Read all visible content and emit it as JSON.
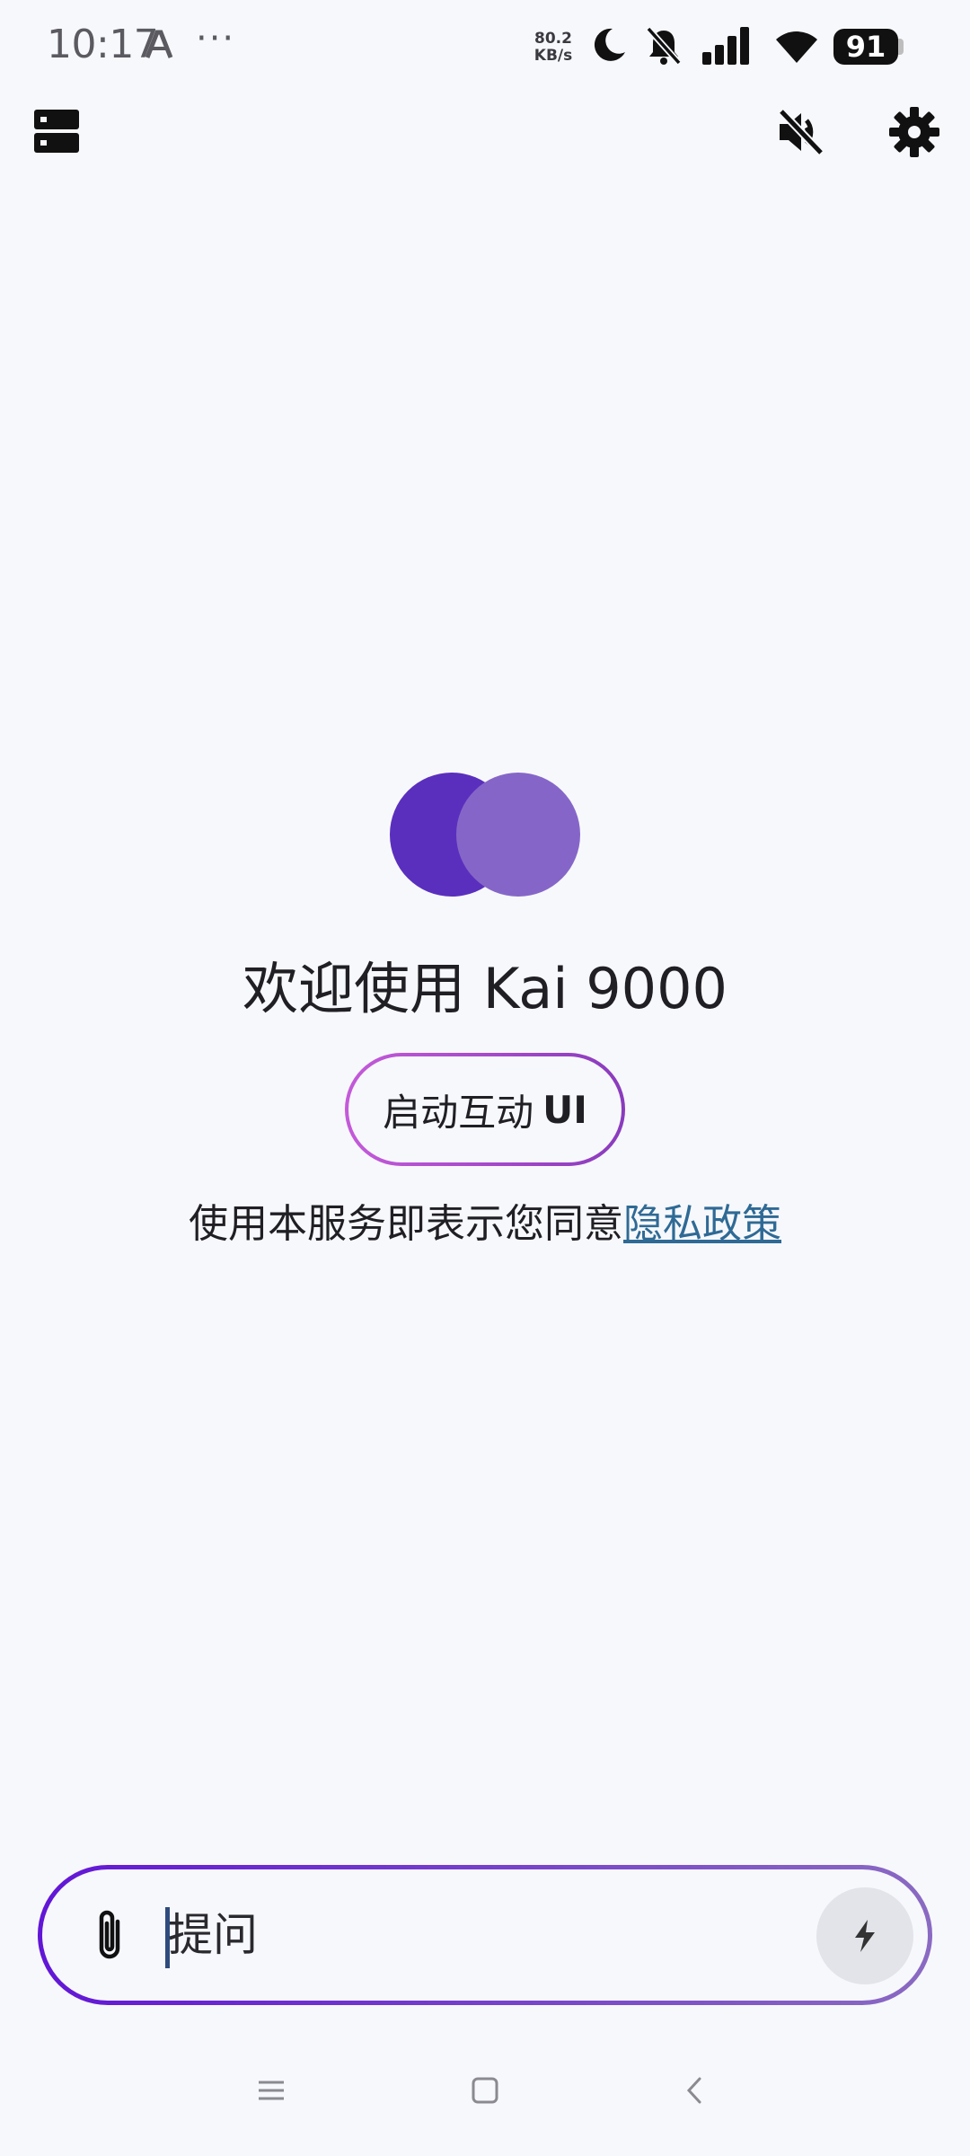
{
  "status_bar": {
    "time": "10:17",
    "more_dots": "···",
    "net_speed_value": "80.2",
    "net_speed_unit": "KB/s",
    "battery": "91"
  },
  "welcome": {
    "title": "欢迎使用 Kai 9000",
    "start_button_text": "启动互动",
    "start_button_ui": "UI",
    "consent_text": "使用本服务即表示您同意",
    "privacy_link": "隐私政策",
    "logo_colors": [
      "#5a2fbd",
      "#8566c8"
    ]
  },
  "input_bar": {
    "placeholder": "提问"
  },
  "icons": {
    "top_left": "server-list-icon",
    "top_right_1": "volume-off-icon",
    "top_right_2": "gear-icon",
    "attach": "paperclip-icon",
    "send": "lightning-icon"
  },
  "colors": {
    "background": "#f7f8fc",
    "link": "#2f6a95",
    "input_border_start": "#6216d6",
    "input_border_end": "#8a6ac2"
  }
}
